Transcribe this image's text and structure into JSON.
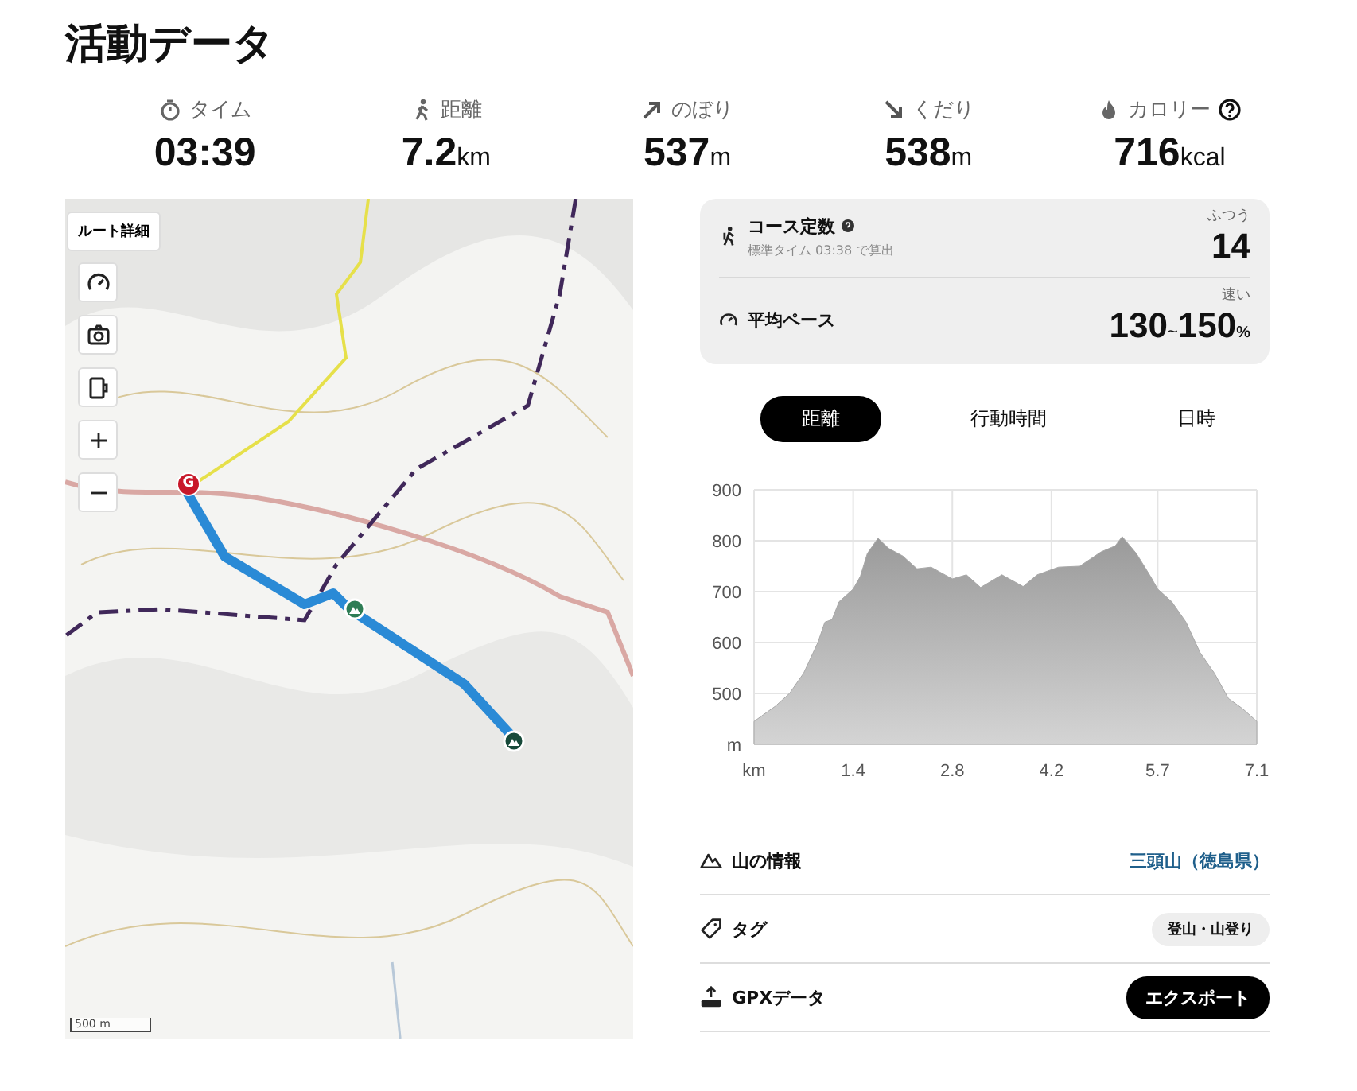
{
  "title": "活動データ",
  "stats": [
    {
      "kind": "time",
      "label": "タイム",
      "value": "03:39",
      "help": false
    },
    {
      "kind": "distance",
      "label": "距離",
      "value": "7.2",
      "unit": "km",
      "help": false
    },
    {
      "kind": "up",
      "label": "のぼり",
      "value": "537",
      "unit": "m",
      "help": false
    },
    {
      "kind": "down",
      "label": "くだり",
      "value": "538",
      "unit": "m",
      "help": false
    },
    {
      "kind": "calorie",
      "label": "カロリー",
      "value": "716",
      "unit": "kcal",
      "help": true
    }
  ],
  "map": {
    "route_button": "ルート詳細",
    "controls": [
      {
        "kind": "gauge"
      },
      {
        "kind": "camera"
      },
      {
        "kind": "mug"
      },
      {
        "kind": "plus"
      },
      {
        "kind": "minus"
      }
    ],
    "goal_marker": "G",
    "scale": "500 m"
  },
  "course_card": [
    {
      "kind": "course",
      "label": "コース定数",
      "help": true,
      "note": "標準タイム 03:38 で算出",
      "rating": "ふつう",
      "value": "14"
    },
    {
      "kind": "pace",
      "label": "平均ペース",
      "help": false,
      "rating": "速い",
      "value": "130",
      "range_mark": "~",
      "value_to": "150",
      "unit": "%"
    }
  ],
  "tabs": [
    {
      "label": "距離",
      "selected": true
    },
    {
      "label": "行動時間",
      "selected": false
    },
    {
      "label": "日時",
      "selected": false
    }
  ],
  "chart_data": {
    "type": "area",
    "grid": true,
    "xlim": [
      0,
      7.1
    ],
    "ylim": [
      400,
      900
    ],
    "xticks": [
      {
        "value": 0,
        "label": "km"
      },
      1.4,
      2.8,
      4.2,
      5.7,
      7.1
    ],
    "yticks": [
      {
        "value": 400,
        "label": "m"
      },
      500,
      600,
      700,
      800,
      900
    ],
    "x": [
      0,
      0.3,
      0.5,
      0.7,
      0.9,
      1.0,
      1.1,
      1.2,
      1.4,
      1.5,
      1.6,
      1.75,
      1.9,
      2.1,
      2.3,
      2.5,
      2.8,
      3.0,
      3.2,
      3.5,
      3.8,
      4.0,
      4.3,
      4.6,
      4.9,
      5.1,
      5.2,
      5.4,
      5.6,
      5.7,
      5.9,
      6.1,
      6.3,
      6.5,
      6.7,
      6.9,
      7.1
    ],
    "series": [
      {
        "color": "#a8a8a8",
        "values": [
          445,
          475,
          500,
          540,
          600,
          640,
          645,
          680,
          705,
          730,
          775,
          805,
          785,
          770,
          745,
          748,
          725,
          733,
          708,
          733,
          710,
          733,
          748,
          750,
          778,
          790,
          808,
          775,
          730,
          705,
          680,
          640,
          580,
          540,
          490,
          470,
          445
        ]
      }
    ]
  },
  "info": [
    {
      "kind": "mountain",
      "label": "山の情報",
      "value": "三頭山（徳島県）"
    },
    {
      "kind": "tag",
      "label": "タグ",
      "value": "登山・山登り"
    },
    {
      "kind": "gpx",
      "label": "GPXデータ",
      "value": "エクスポート"
    }
  ]
}
